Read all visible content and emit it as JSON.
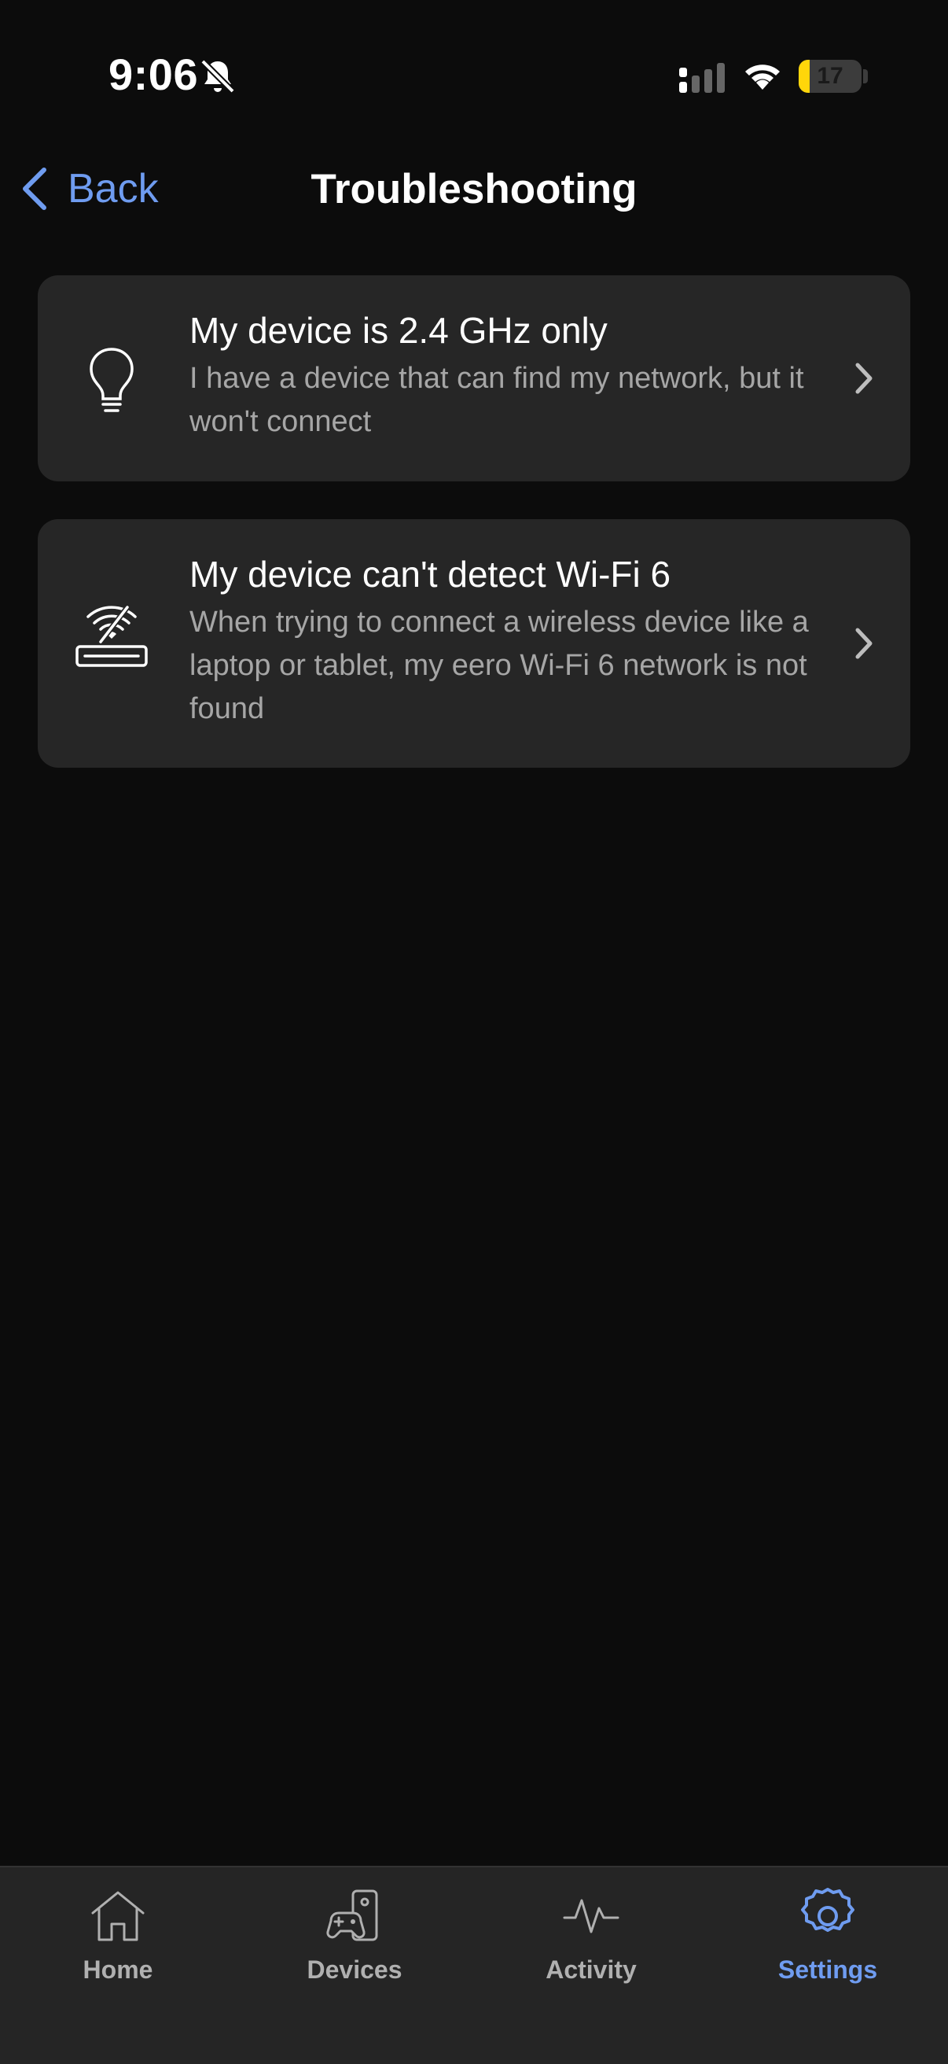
{
  "status_bar": {
    "time": "9:06",
    "battery_level": "17",
    "battery_fraction": 0.17,
    "icons": [
      "bell-slash-icon",
      "cellular-signal-icon",
      "wifi-icon",
      "battery-icon"
    ]
  },
  "header": {
    "back_label": "Back",
    "title": "Troubleshooting"
  },
  "cards": [
    {
      "icon": "lightbulb-icon",
      "title": "My device is 2.4 GHz only",
      "description": "I have a device that can find my network, but it won't connect"
    },
    {
      "icon": "router-wifi-off-icon",
      "title": "My device can't detect Wi-Fi 6",
      "description": "When trying to connect a wireless device like a laptop or tablet, my eero Wi-Fi 6 network is not found"
    }
  ],
  "tab_bar": {
    "items": [
      {
        "label": "Home",
        "icon": "home-icon",
        "active": false
      },
      {
        "label": "Devices",
        "icon": "devices-icon",
        "active": false
      },
      {
        "label": "Activity",
        "icon": "activity-icon",
        "active": false
      },
      {
        "label": "Settings",
        "icon": "gear-icon",
        "active": true
      }
    ]
  },
  "colors": {
    "background": "#0c0c0c",
    "card": "#262626",
    "accent": "#6f9cf0",
    "battery": "#ffd60a",
    "secondary_text": "#a6a6a6"
  }
}
